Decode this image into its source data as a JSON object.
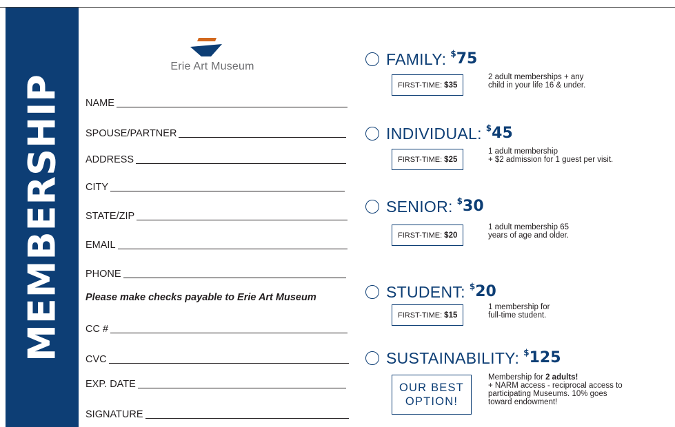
{
  "banner": {
    "text": "MEMBERSHIP"
  },
  "logo": {
    "text": "Erie Art Museum"
  },
  "form": {
    "fields": [
      {
        "label": "NAME"
      },
      {
        "label": "SPOUSE/PARTNER"
      },
      {
        "label": "ADDRESS"
      },
      {
        "label": "CITY"
      },
      {
        "label": "STATE/ZIP"
      },
      {
        "label": "EMAIL"
      },
      {
        "label": "PHONE"
      }
    ],
    "checks_note": "Please make checks payable to Erie Art Museum",
    "payment_fields": [
      {
        "label": "CC #"
      },
      {
        "label": "CVC"
      },
      {
        "label": "EXP. DATE"
      },
      {
        "label": "SIGNATURE"
      }
    ]
  },
  "tiers": [
    {
      "name": "FAMILY:",
      "dollar": "$",
      "price": "75",
      "first_time_label": "FIRST-TIME:",
      "first_time_price": "$35",
      "desc": [
        "2 adult memberships + any",
        "child in your life 16 & under."
      ]
    },
    {
      "name": "INDIVIDUAL:",
      "dollar": "$",
      "price": "45",
      "first_time_label": "FIRST-TIME:",
      "first_time_price": "$25",
      "desc": [
        "1 adult membership",
        "+  $2 admission for 1 guest per visit."
      ]
    },
    {
      "name": "SENIOR:",
      "dollar": "$",
      "price": "30",
      "first_time_label": "FIRST-TIME:",
      "first_time_price": "$20",
      "desc": [
        "1 adult membership 65",
        "years of age and older."
      ]
    },
    {
      "name": "STUDENT:",
      "dollar": "$",
      "price": "20",
      "first_time_label": "FIRST-TIME:",
      "first_time_price": "$15",
      "desc": [
        "1 membership for",
        "full-time student."
      ]
    },
    {
      "name": "SUSTAINABILITY:",
      "dollar": "$",
      "price": "125",
      "best_option": [
        "OUR BEST",
        "OPTION!"
      ],
      "desc_prefix": "Membership for ",
      "desc_bold": "2 adults!",
      "desc_lines": [
        "+ NARM access - reciprocal access to",
        "participating Museums. 10% goes",
        "toward endowment!"
      ]
    }
  ],
  "colors": {
    "navy": "#0d3e75",
    "logo_orange": "#d2691e",
    "text": "#231f20",
    "gray": "#6d6e71"
  }
}
